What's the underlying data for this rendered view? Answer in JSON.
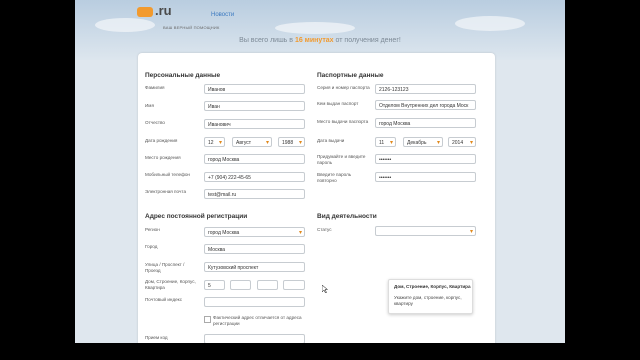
{
  "header": {
    "logo": ".ru",
    "logo_sub": "ВАШ ВЕРНЫЙ ПОМОЩНИК",
    "top_link": "Новости",
    "tagline_pre": "Вы всего лишь в ",
    "tagline_highlight": "16 минутах",
    "tagline_post": " от получения денег!"
  },
  "personal": {
    "title": "Персональные данные",
    "surname_label": "Фамилия",
    "surname": "Иванов",
    "name_label": "Имя",
    "name": "Иван",
    "patronymic_label": "Отчество",
    "patronymic": "Иванович",
    "birthdate_label": "Дата рождения",
    "birth_day": "12",
    "birth_month": "Август",
    "birth_year": "1988",
    "birthplace_label": "Место рождения",
    "birthplace": "город Москва",
    "phone_label": "Мобильный телефон",
    "phone": "+7 (904) 222-45-65",
    "email_label": "Электронная почта",
    "email": "test@mail.ru"
  },
  "passport": {
    "title": "Паспортные данные",
    "series_label": "Серия и номер паспорта",
    "series": "2126-123123",
    "issued_by_label": "Кем выдан паспорт",
    "issued_by": "Отделом Внутренних дел города Моск",
    "issue_place_label": "Место выдачи паспорта",
    "issue_place": "город Москва",
    "issue_date_label": "Дата выдачи",
    "issue_day": "11",
    "issue_month": "Декабрь",
    "issue_year": "2014",
    "password_label": "Придумайте и введите пароль",
    "password": "•••••••",
    "password_repeat_label": "Введите пароль повторно",
    "password_repeat": "•••••••"
  },
  "address": {
    "title": "Адрес постоянной регистрации",
    "region_label": "Регион",
    "region": "город Москва",
    "city_label": "Город",
    "city": "Москва",
    "street_label": "Улица / Проспект / Проезд",
    "street": "Кутузовский проспект",
    "house_label": "Дом, Строение, Корпус, Квартира",
    "house": "5",
    "postcode_label": "Почтовый индекс",
    "diff_address_label": "Фактический адрес отличается от адреса регистрации",
    "extra_label": "Прием код"
  },
  "activity": {
    "title": "Вид деятельности",
    "status_label": "Статус"
  },
  "hint": {
    "title": "Дом, Строение, Корпус, Квартира",
    "text": "Укажите дом, строение, корпус, квартиру"
  }
}
